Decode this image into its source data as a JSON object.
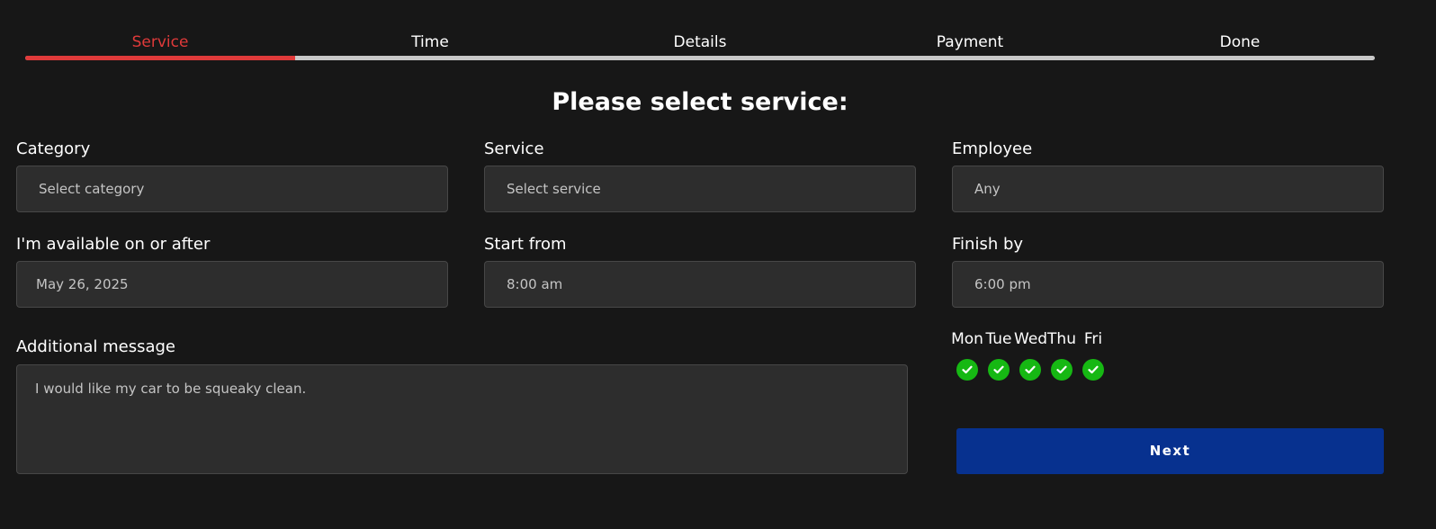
{
  "colors": {
    "active_step": "#e03a3a",
    "check": "#16b813",
    "next_button": "#07318f"
  },
  "steps": [
    {
      "label": "Service",
      "active": true
    },
    {
      "label": "Time",
      "active": false
    },
    {
      "label": "Details",
      "active": false
    },
    {
      "label": "Payment",
      "active": false
    },
    {
      "label": "Done",
      "active": false
    }
  ],
  "progress": {
    "completed_steps": 1,
    "total_steps": 5
  },
  "heading": "Please select service:",
  "form": {
    "category": {
      "label": "Category",
      "value": "Select category"
    },
    "service": {
      "label": "Service",
      "value": "Select service"
    },
    "employee": {
      "label": "Employee",
      "value": "Any"
    },
    "available_date": {
      "label": "I'm available on or after",
      "value": "May 26, 2025"
    },
    "start_from": {
      "label": "Start from",
      "value": "8:00 am"
    },
    "finish_by": {
      "label": "Finish by",
      "value": "6:00 pm"
    },
    "message": {
      "label": "Additional message",
      "value": "I would like my car to be squeaky clean."
    }
  },
  "days": [
    {
      "label": "Mon",
      "checked": true
    },
    {
      "label": "Tue",
      "checked": true
    },
    {
      "label": "Wed",
      "checked": true
    },
    {
      "label": "Thu",
      "checked": true
    },
    {
      "label": "Fri",
      "checked": true
    }
  ],
  "next_button": {
    "label": "Next",
    "icon": "check-icon"
  }
}
